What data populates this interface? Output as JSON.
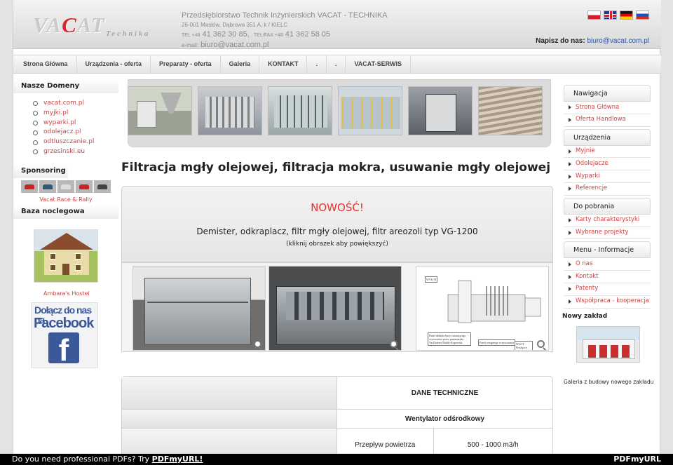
{
  "header": {
    "logo_word_gray": "VA",
    "logo_word_red": "C",
    "logo_word_gray2": "AT",
    "logo_sub": "Technika",
    "company_line1": "Przedsiębiorstwo Technik Inżynierskich VACAT - TECHNIKA",
    "company_line2": "26-001 Masłów, Dąbrowa 351 A, k / KIELC",
    "tel_label": "TEL +48",
    "tel": "41 362 30 85,",
    "fax_label": "TEL/FAX +48",
    "fax": "41 362 58 05",
    "email_label": "e-mail:",
    "email": "biuro@vacat.com.pl",
    "contact_label": "Napisz do nas:",
    "contact_email": "biuro@vacat.com.pl",
    "flags": [
      "flag-pl",
      "flag-en",
      "flag-de",
      "flag-ru"
    ]
  },
  "nav": {
    "items": [
      "Strona Główna",
      "Urządzenia - oferta",
      "Preparaty - oferta",
      "Galeria",
      "KONTAKT",
      ".",
      ".",
      "VACAT-SERWIS"
    ]
  },
  "left": {
    "domeny_title": "Nasze Domeny",
    "domeny": [
      "vacat.com.pl",
      "myjki.pl",
      "wyparki.pl",
      "odolejacz.pl",
      "odtluszczanie.pl",
      "grzesinski.eu"
    ],
    "sponsoring_title": "Sponsoring",
    "sponsor_caption": "Vacat Race & Rally",
    "baza_title": "Baza noclegowa",
    "hostel_caption": "Ambara's Hostel",
    "fb_line1": "Dołącz do nas na",
    "fb_line2": "Facebook",
    "fb_letter": "f"
  },
  "main": {
    "title": "Filtracja mgły olejowej, filtracja mokra, usuwanie mgły olejowej",
    "nowosc": "NOWOŚĆ!",
    "description": "Demister, odkraplacz, filtr mgły olejowej, filtr areozoli typ VG-1200",
    "hint": "(kliknij obrazek aby powiększyć)",
    "diagram_labels": {
      "wylot": "WYLOT",
      "panel": "Panel układu dyszy zraszającego czyszczenia przez pneumatyka VacDrainer Raddy-Kopowala",
      "panel2": "Panel wstępnego oczyszczania",
      "wlot": "WLOT Przyłącze"
    },
    "table": {
      "header": "DANE TECHNICZNE",
      "subheader": "Wentylator odśrodkowy",
      "row_label": "Przepływ powietrza",
      "row_value": "500 - 1000 m3/h"
    }
  },
  "right": {
    "groups": [
      {
        "title": "Nawigacja",
        "items": [
          "Strona Główna",
          "Oferta Handlowa"
        ]
      },
      {
        "title": "Urządzenia",
        "items": [
          "Myjnie",
          "Odolejacze",
          "Wyparki",
          "Referencje"
        ]
      },
      {
        "title": "Do pobrania",
        "items": [
          "Karty charakterystyki",
          "Wybrane projekty"
        ]
      },
      {
        "title": "Menu - Informacje",
        "items": [
          "O nas",
          "Kontakt",
          "Patenty",
          "Współpraca - kooperacja"
        ]
      }
    ],
    "nowy_zaklad": "Nowy zakład",
    "galeria_caption": "Galeria z budowy nowego zakładu"
  },
  "footer": {
    "text": "Do you need professional PDFs? Try ",
    "link": "PDFmyURL!",
    "logo": "PDFmyURL"
  },
  "colors": {
    "accent_red": "#c94545",
    "nowosc_red": "#e0342c",
    "link_blue": "#2a53a8",
    "facebook_blue": "#3b5998"
  }
}
